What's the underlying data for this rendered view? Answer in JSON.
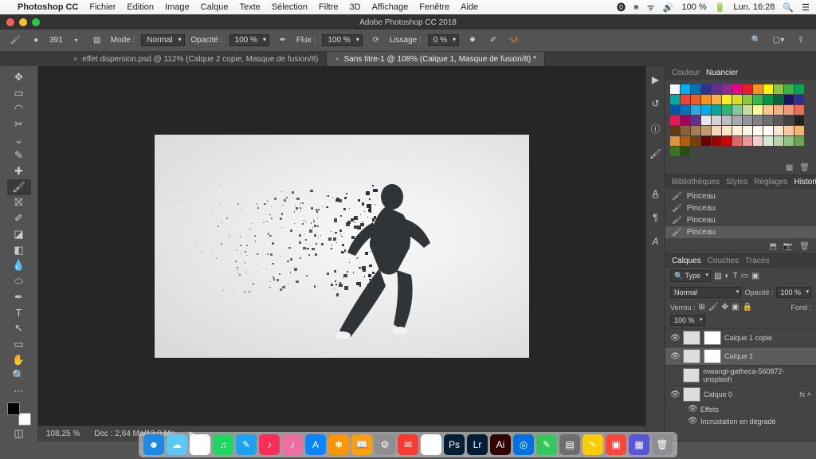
{
  "menubar": {
    "apple": "",
    "app": "Photoshop CC",
    "items": [
      "Fichier",
      "Edition",
      "Image",
      "Calque",
      "Texte",
      "Sélection",
      "Filtre",
      "3D",
      "Affichage",
      "Fenêtre",
      "Aide"
    ],
    "battery": "100 %",
    "clock": "Lun. 16:28"
  },
  "window": {
    "title": "Adobe Photoshop CC 2018"
  },
  "options": {
    "brush_size": "391",
    "mode_label": "Mode :",
    "mode_value": "Normal",
    "opacity_label": "Opacité :",
    "opacity_value": "100 %",
    "flow_label": "Flux :",
    "flow_value": "100 %",
    "smooth_label": "Lissage :",
    "smooth_value": "0 %"
  },
  "tabs": [
    {
      "label": "effet dispersion.psd @ 112% (Calque 2 copie, Masque de fusion/8)",
      "active": false
    },
    {
      "label": "Sans titre-1 @ 108% (Calque 1, Masque de fusion/8) *",
      "active": true
    }
  ],
  "statusbar": {
    "zoom": "108,25 %",
    "doc": "Doc : 2,64 Mo/13,0 Mo"
  },
  "color_panel": {
    "tabs": [
      "Couleur",
      "Nuancier"
    ],
    "active": 1,
    "swatches": [
      "#ffffff",
      "#00aeef",
      "#0072bc",
      "#2e3192",
      "#662d91",
      "#92278f",
      "#ec008c",
      "#ed1c24",
      "#f7941d",
      "#fff200",
      "#8dc63f",
      "#39b54a",
      "#00a651",
      "#00a99d",
      "#ef4136",
      "#f15a29",
      "#f7941d",
      "#fbb040",
      "#fcee21",
      "#d7df23",
      "#8dc63f",
      "#39b54a",
      "#009444",
      "#006837",
      "#1b1464",
      "#2e3192",
      "#0054a6",
      "#0072bc",
      "#29abe2",
      "#00aeef",
      "#00a99d",
      "#2bb673",
      "#82ca9c",
      "#c4df9b",
      "#fff799",
      "#fdc689",
      "#f9ad81",
      "#f69679",
      "#f26c4f",
      "#ed145b",
      "#9e005d",
      "#662d91",
      "#e6e7e8",
      "#d1d3d4",
      "#bcbec0",
      "#a7a9ac",
      "#939598",
      "#808285",
      "#6d6e71",
      "#58595b",
      "#414042",
      "#231f20",
      "#603913",
      "#8b5e3c",
      "#a67c52",
      "#c49a6c",
      "#f1d9b5",
      "#fde6c2",
      "#fff2d7",
      "#fef6e4",
      "#fff9ee",
      "#fffdf6",
      "#fce5cd",
      "#f9cb9c",
      "#f6b26b",
      "#e69138",
      "#b45f06",
      "#783f04",
      "#660000",
      "#990000",
      "#cc0000",
      "#e06666",
      "#ea9999",
      "#f4cccc",
      "#d9ead3",
      "#b6d7a8",
      "#93c47d",
      "#6aa84f",
      "#38761d",
      "#274e13"
    ]
  },
  "history_panel": {
    "tabs": [
      "Bibliothèques",
      "Styles",
      "Réglages",
      "Historique"
    ],
    "active": 3,
    "items": [
      "Pinceau",
      "Pinceau",
      "Pinceau",
      "Pinceau"
    ]
  },
  "layers_panel": {
    "tabs": [
      "Calques",
      "Couches",
      "Tracés"
    ],
    "active": 0,
    "filter_label": "Type",
    "blend_mode": "Normal",
    "opacity_label": "Opacité :",
    "opacity_value": "100 %",
    "lock_label": "Verrou :",
    "fill_label": "Fond :",
    "fill_value": "100 %",
    "layers": [
      {
        "visible": true,
        "name": "Calque 1 copie",
        "mask": true
      },
      {
        "visible": true,
        "name": "Calque 1",
        "mask": true,
        "selected": true
      },
      {
        "visible": false,
        "name": "mwangi-gatheca-560872-unsplash"
      },
      {
        "visible": true,
        "name": "Calque 0",
        "fx": true
      }
    ],
    "fx_children": [
      "Effets",
      "Incrustation en dégradé"
    ]
  },
  "dock": [
    {
      "bg": "#1e88e5",
      "t": "☻"
    },
    {
      "bg": "#5ac8fa",
      "t": "☁"
    },
    {
      "bg": "#fff",
      "t": "◐"
    },
    {
      "bg": "#1ed760",
      "t": "♫"
    },
    {
      "bg": "#1da1f2",
      "t": "✎"
    },
    {
      "bg": "#ff2d55",
      "t": "♪"
    },
    {
      "bg": "#ed6ea0",
      "t": "♪"
    },
    {
      "bg": "#0a84ff",
      "t": "A"
    },
    {
      "bg": "#ff9500",
      "t": "✱"
    },
    {
      "bg": "#ff9f0a",
      "t": "📖"
    },
    {
      "bg": "#8e8e93",
      "t": "⚙"
    },
    {
      "bg": "#ff3b30",
      "t": "✉"
    },
    {
      "bg": "#fff",
      "t": "26"
    },
    {
      "bg": "#001e36",
      "t": "Ps"
    },
    {
      "bg": "#001e36",
      "t": "Lr"
    },
    {
      "bg": "#330000",
      "t": "Ai"
    },
    {
      "bg": "#0071e3",
      "t": "◎"
    },
    {
      "bg": "#34c759",
      "t": "✎"
    },
    {
      "bg": "#6e6e6e",
      "t": "▤"
    },
    {
      "bg": "#ffcc00",
      "t": "✎"
    },
    {
      "bg": "#ff453a",
      "t": "▣"
    },
    {
      "bg": "#5856d6",
      "t": "▦"
    },
    {
      "bg": "#8e8e93",
      "t": "🗑"
    }
  ]
}
